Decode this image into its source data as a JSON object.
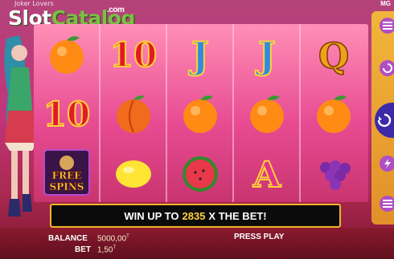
{
  "header": {
    "game_title": "Joker Lovers",
    "provider": "MG"
  },
  "watermark": {
    "slot": "Slot",
    "catalog": "Catalog",
    "com": ".com"
  },
  "reels": [
    [
      "orange",
      "10",
      "free-spins"
    ],
    [
      "10",
      "peach",
      "lemon"
    ],
    [
      "J",
      "orange",
      "watermelon"
    ],
    [
      "J",
      "orange",
      "A"
    ],
    [
      "Q",
      "orange",
      "grapes"
    ]
  ],
  "symbols": {
    "ten": "10",
    "jack": "J",
    "queen": "Q",
    "ace": "A",
    "free": "FREE",
    "spins": "SPINS"
  },
  "banner": {
    "prefix": "WIN UP TO",
    "amount": "2835",
    "suffix": "X THE BET!"
  },
  "info": {
    "balance_label": "BALANCE",
    "balance_value": "5000,00",
    "bet_label": "BET",
    "bet_value": "1,50",
    "currency_symbol": "T"
  },
  "actions": {
    "press_play": "PRESS PLAY"
  },
  "colors": {
    "accent": "#f0b429",
    "reel_bg": "#e84c93",
    "banner_bg": "#0b0b0b",
    "highlight": "#ffd23a"
  }
}
